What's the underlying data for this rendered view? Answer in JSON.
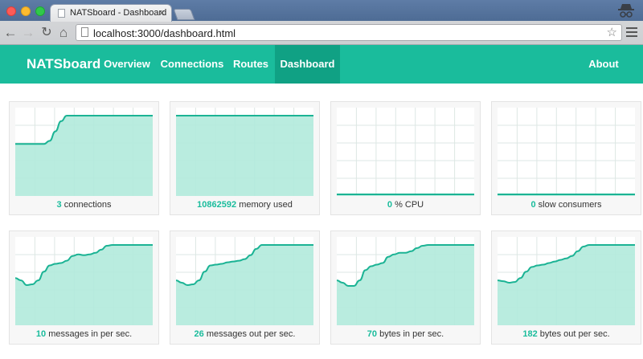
{
  "browser": {
    "tab_title": "NATSboard - Dashboard",
    "tab_close": "×",
    "url": "localhost:3000/dashboard.html",
    "back_glyph": "←",
    "forward_glyph": "→",
    "reload_glyph": "↻",
    "home_glyph": "⌂",
    "star_glyph": "☆",
    "icons": [
      "back-arrow-icon",
      "forward-arrow-icon",
      "reload-icon",
      "home-icon",
      "page-icon",
      "star-icon",
      "menu-icon",
      "incognito-icon",
      "favicon-icon"
    ]
  },
  "navbar": {
    "brand": "NATSboard",
    "items": [
      {
        "label": "Overview"
      },
      {
        "label": "Connections"
      },
      {
        "label": "Routes"
      },
      {
        "label": "Dashboard",
        "active": true
      }
    ],
    "about": "About"
  },
  "colors": {
    "accent": "#1abc9c",
    "active_nav": "#10a184",
    "line": "#1bb394",
    "fill": "#b1eadb",
    "grid": "#dde7e4"
  },
  "cards": [
    {
      "value": "3",
      "label": "connections"
    },
    {
      "value": "10862592",
      "label": "memory used"
    },
    {
      "value": "0",
      "label": "% CPU"
    },
    {
      "value": "0",
      "label": "slow consumers"
    },
    {
      "value": "10",
      "label": "messages in per sec."
    },
    {
      "value": "26",
      "label": "messages out per sec."
    },
    {
      "value": "70",
      "label": "bytes in per sec."
    },
    {
      "value": "182",
      "label": "bytes out per sec."
    }
  ],
  "chart_data": [
    {
      "type": "area",
      "ylim": [
        0,
        1
      ],
      "values": [
        0.64,
        0.64,
        0.64,
        0.64,
        0.64,
        0.64,
        0.68,
        0.8,
        0.93,
        1,
        1,
        1,
        1,
        1,
        1,
        1,
        1,
        1,
        1,
        1,
        1,
        1,
        1,
        1,
        1
      ]
    },
    {
      "type": "area",
      "ylim": [
        0,
        1
      ],
      "values": [
        1,
        1,
        1,
        1,
        1,
        1,
        1,
        1,
        1,
        1,
        1,
        1,
        1,
        1,
        1,
        1,
        1,
        1,
        1,
        1,
        1,
        1,
        1,
        1,
        1
      ]
    },
    {
      "type": "area",
      "ylim": [
        0,
        1
      ],
      "values": [
        0,
        0,
        0,
        0,
        0,
        0,
        0,
        0,
        0,
        0,
        0,
        0,
        0,
        0,
        0,
        0,
        0,
        0,
        0,
        0,
        0,
        0,
        0,
        0,
        0
      ]
    },
    {
      "type": "area",
      "ylim": [
        0,
        1
      ],
      "values": [
        0,
        0,
        0,
        0,
        0,
        0,
        0,
        0,
        0,
        0,
        0,
        0,
        0,
        0,
        0,
        0,
        0,
        0,
        0,
        0,
        0,
        0,
        0,
        0,
        0
      ]
    },
    {
      "type": "area",
      "ylim": [
        0,
        1
      ],
      "values": [
        0.58,
        0.55,
        0.49,
        0.5,
        0.55,
        0.66,
        0.74,
        0.76,
        0.77,
        0.8,
        0.86,
        0.88,
        0.87,
        0.88,
        0.9,
        0.94,
        0.99,
        1,
        1,
        1,
        1,
        1,
        1,
        1,
        1
      ]
    },
    {
      "type": "area",
      "ylim": [
        0,
        1
      ],
      "values": [
        0.55,
        0.52,
        0.49,
        0.5,
        0.55,
        0.66,
        0.74,
        0.75,
        0.76,
        0.78,
        0.79,
        0.8,
        0.82,
        0.87,
        0.95,
        1,
        1,
        1,
        1,
        1,
        1,
        1,
        1,
        1,
        1
      ]
    },
    {
      "type": "area",
      "ylim": [
        0,
        1
      ],
      "values": [
        0.55,
        0.52,
        0.48,
        0.48,
        0.55,
        0.68,
        0.73,
        0.75,
        0.77,
        0.85,
        0.88,
        0.9,
        0.9,
        0.92,
        0.96,
        0.99,
        1,
        1,
        1,
        1,
        1,
        1,
        1,
        1,
        1
      ]
    },
    {
      "type": "area",
      "ylim": [
        0,
        1
      ],
      "values": [
        0.55,
        0.54,
        0.52,
        0.53,
        0.58,
        0.66,
        0.72,
        0.74,
        0.75,
        0.77,
        0.79,
        0.81,
        0.83,
        0.86,
        0.92,
        0.98,
        1,
        1,
        1,
        1,
        1,
        1,
        1,
        1,
        1
      ]
    }
  ]
}
